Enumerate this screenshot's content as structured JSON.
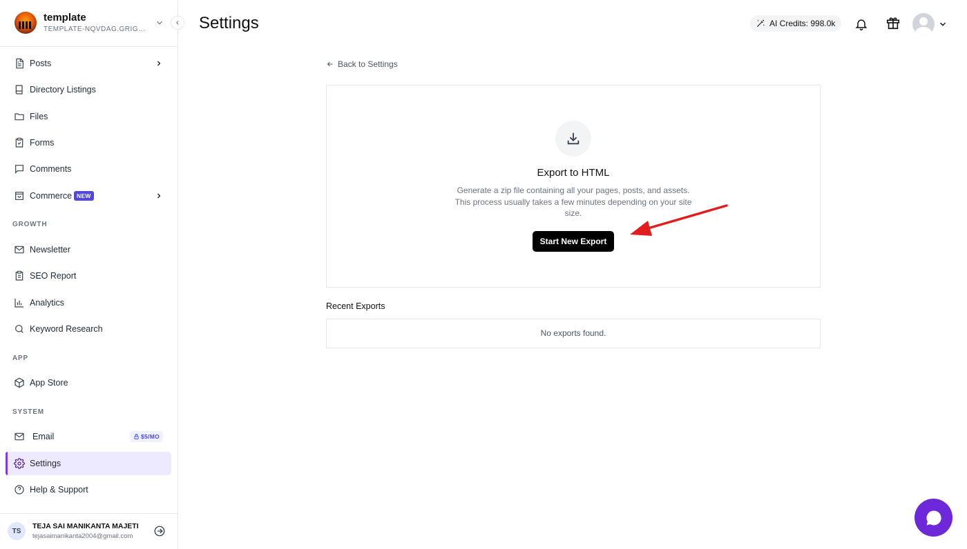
{
  "workspace": {
    "name": "template",
    "subdomain": "TEMPLATE-NQVDAG.GRIGORA.COM"
  },
  "sidebar": {
    "items": [
      {
        "label": "Posts"
      },
      {
        "label": "Directory Listings"
      },
      {
        "label": "Files"
      },
      {
        "label": "Forms"
      },
      {
        "label": "Comments"
      },
      {
        "label": "Commerce",
        "badge": "NEW"
      }
    ],
    "sections": {
      "growth": "GROWTH",
      "app": "APP",
      "system": "SYSTEM"
    },
    "growth_items": [
      {
        "label": "Newsletter"
      },
      {
        "label": "SEO Report"
      },
      {
        "label": "Analytics"
      },
      {
        "label": "Keyword Research"
      }
    ],
    "app_items": [
      {
        "label": "App Store"
      }
    ],
    "system_items": [
      {
        "label": "Email",
        "badge": "$5/MO"
      },
      {
        "label": "Settings",
        "active": true
      },
      {
        "label": "Help & Support"
      }
    ]
  },
  "user": {
    "initials": "TS",
    "name": "TEJA SAI MANIKANTA MAJETI",
    "email": "tejasaimanikanta2004@gmail.com"
  },
  "header": {
    "title": "Settings",
    "credits": "AI Credits: 998.0k"
  },
  "main": {
    "back_label": "Back to Settings",
    "export": {
      "title": "Export to HTML",
      "description": "Generate a zip file containing all your pages, posts, and assets. This process usually takes a few minutes depending on your site size.",
      "button": "Start New Export"
    },
    "recent_title": "Recent Exports",
    "empty_text": "No exports found."
  },
  "colors": {
    "accent": "#7c3aed",
    "active_bg": "#ede9fe",
    "annotation_arrow": "#e11d1d",
    "chat": "#6d28d9"
  }
}
